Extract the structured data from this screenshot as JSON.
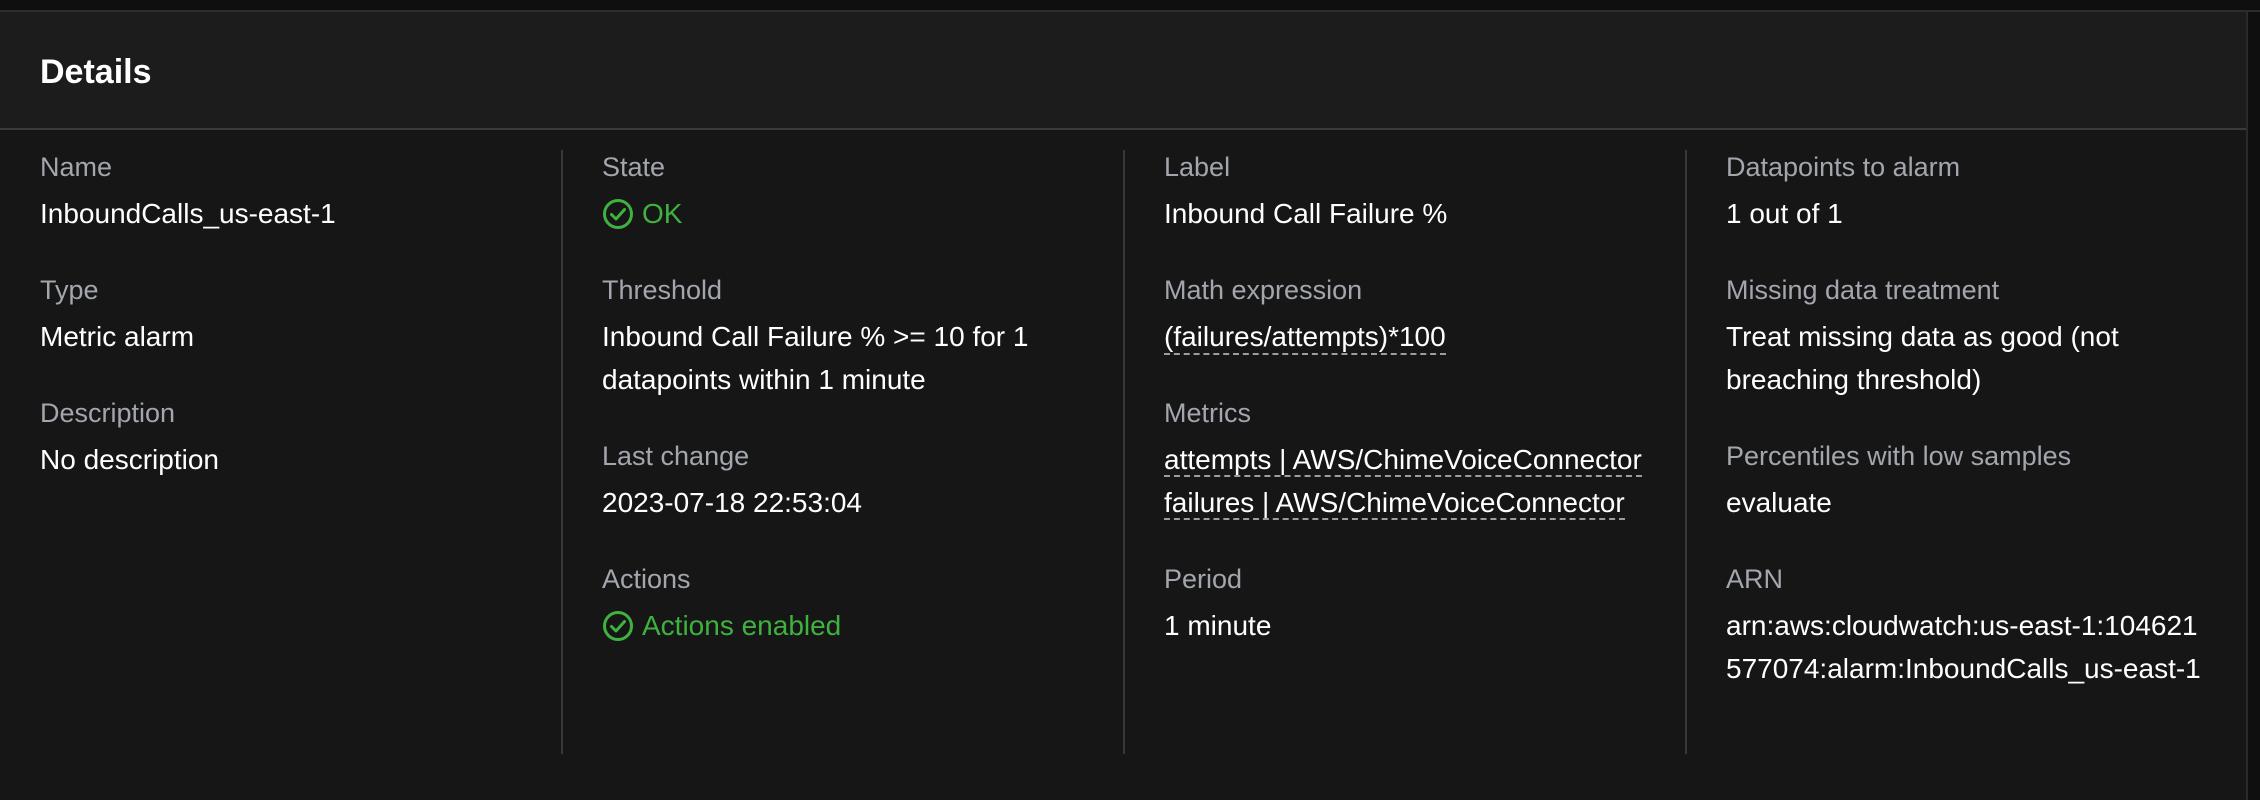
{
  "panel": {
    "title": "Details"
  },
  "colors": {
    "status_ok": "#3fb13f",
    "label": "#a3a6ad",
    "value": "#ffffff",
    "background": "#161617"
  },
  "col1": {
    "name": {
      "label": "Name",
      "value": "InboundCalls_us-east-1"
    },
    "type": {
      "label": "Type",
      "value": "Metric alarm"
    },
    "description": {
      "label": "Description",
      "value": "No description"
    }
  },
  "col2": {
    "state": {
      "label": "State",
      "value": "OK",
      "icon": "check-circle-icon"
    },
    "threshold": {
      "label": "Threshold",
      "value": "Inbound Call Failure % >= 10 for 1 datapoints within 1 minute"
    },
    "last_change": {
      "label": "Last change",
      "value": "2023-07-18 22:53:04"
    },
    "actions": {
      "label": "Actions",
      "value": "Actions enabled",
      "icon": "check-circle-icon"
    }
  },
  "col3": {
    "label_field": {
      "label": "Label",
      "value": "Inbound Call Failure %"
    },
    "math_expression": {
      "label": "Math expression",
      "value": "(failures/attempts)*100"
    },
    "metrics": {
      "label": "Metrics",
      "items": [
        "attempts | AWS/ChimeVoiceConnector",
        "failures | AWS/ChimeVoiceConnector"
      ]
    },
    "period": {
      "label": "Period",
      "value": "1 minute"
    }
  },
  "col4": {
    "datapoints": {
      "label": "Datapoints to alarm",
      "value": "1 out of 1"
    },
    "missing_data": {
      "label": "Missing data treatment",
      "value": "Treat missing data as good (not breaching threshold)"
    },
    "percentiles": {
      "label": "Percentiles with low samples",
      "value": "evaluate"
    },
    "arn": {
      "label": "ARN",
      "value": "arn:aws:cloudwatch:us-east-1:104621577074:alarm:InboundCalls_us-east-1"
    }
  }
}
